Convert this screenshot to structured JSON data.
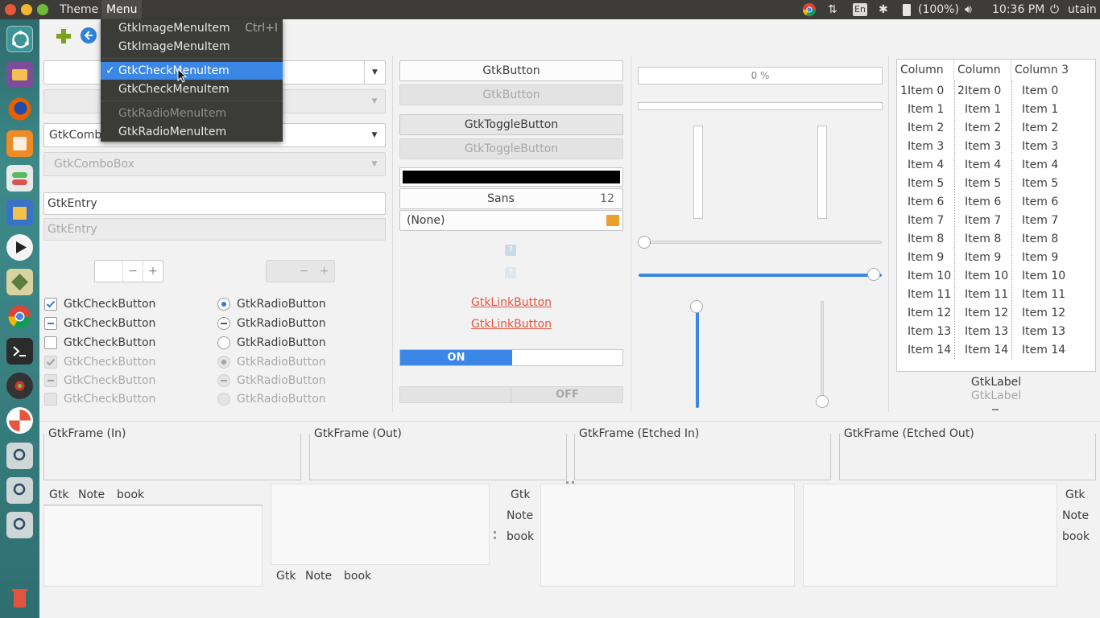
{
  "topbar": {
    "menus": [
      "Theme",
      "Menu"
    ],
    "battery": "(100%)",
    "keyboard": "En",
    "time": "10:36 PM",
    "user": "utain"
  },
  "menu_popup": {
    "items": [
      {
        "label": "GtkImageMenuItem",
        "accel": "Ctrl+I"
      },
      {
        "label": "GtkImageMenuItem",
        "accel": ""
      },
      {
        "label": "GtkCheckMenuItem",
        "state": "checked, highlighted"
      },
      {
        "label": "GtkCheckMenuItem"
      },
      {
        "label": "GtkRadioMenuItem",
        "state": "disabled"
      },
      {
        "label": "GtkRadioMenuItem"
      }
    ]
  },
  "combos": {
    "combo3_value": "GtkComboBoxEntry",
    "combo4_value": "GtkComboBox"
  },
  "entries": {
    "entry1": "GtkEntry",
    "entry2": "GtkEntry"
  },
  "checks": [
    "GtkCheckButton",
    "GtkCheckButton",
    "GtkCheckButton",
    "GtkCheckButton",
    "GtkCheckButton",
    "GtkCheckButton"
  ],
  "radios": [
    "GtkRadioButton",
    "GtkRadioButton",
    "GtkRadioButton",
    "GtkRadioButton",
    "GtkRadioButton",
    "GtkRadioButton"
  ],
  "buttons": {
    "button1": "GtkButton",
    "button2": "GtkButton",
    "toggle1": "GtkToggleButton",
    "toggle2": "GtkToggleButton",
    "font_name": "Sans",
    "font_size": "12",
    "file_chooser": "(None)",
    "link1": "GtkLinkButton",
    "link2": "GtkLinkButton",
    "switch_on": "ON",
    "switch_off": "OFF"
  },
  "progress": {
    "label": "0 %",
    "fraction": 0
  },
  "sliders": {
    "h_scale1": 0.0,
    "h_scale2": 1.0,
    "v_scale1": 1.0,
    "v_scale2": 0.0
  },
  "tree": {
    "columns": [
      "Column 1",
      "Column 2",
      "Column 3"
    ],
    "rows": [
      "Item 0",
      "Item 1",
      "Item 2",
      "Item 3",
      "Item 4",
      "Item 5",
      "Item 6",
      "Item 7",
      "Item 8",
      "Item 9",
      "Item 10",
      "Item 11",
      "Item 12",
      "Item 13",
      "Item 14"
    ]
  },
  "labels": {
    "label1": "GtkLabel",
    "label2": "GtkLabel"
  },
  "frames": [
    "GtkFrame (In)",
    "GtkFrame (Out)",
    "GtkFrame (Etched In)",
    "GtkFrame (Etched Out)"
  ],
  "notebook_tabs": [
    "Gtk",
    "Note",
    "book"
  ],
  "colors": {
    "accent": "#3a87e5",
    "link": "#e8543e",
    "topbar": "#3d3c38",
    "toolbar_add": "#7aa320"
  }
}
